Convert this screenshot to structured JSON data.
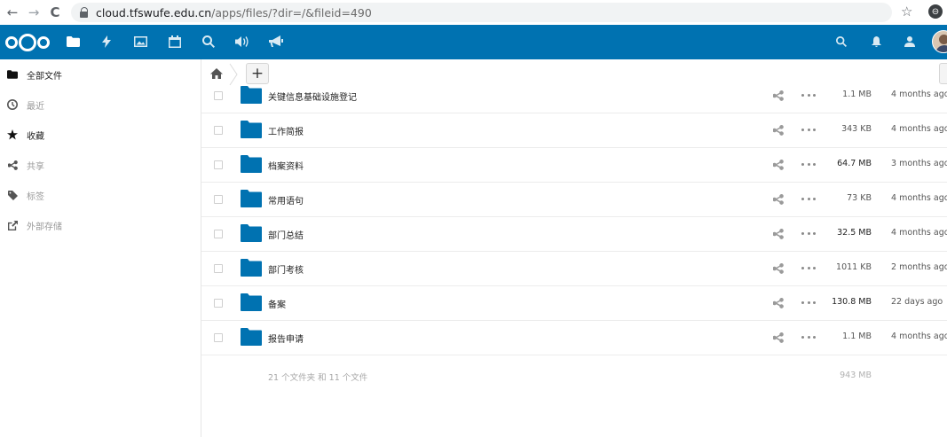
{
  "browser": {
    "back": "←",
    "forward": "→",
    "reload": "C",
    "url_host": "cloud.tfswufe.edu.cn",
    "url_path": "/apps/files/?dir=/&fileid=490",
    "star": "☆",
    "profile": "⊖"
  },
  "header": {
    "app_icons": [
      "files-icon",
      "activity-icon",
      "photos-icon",
      "calendar-icon",
      "search-icon",
      "audio-icon",
      "announcements-icon"
    ],
    "right_icons": [
      "search-icon",
      "notifications-icon",
      "contacts-icon"
    ]
  },
  "sidebar": {
    "items": [
      {
        "label": "全部文件",
        "icon": "folder-icon"
      },
      {
        "label": "最近",
        "icon": "clock-icon"
      },
      {
        "label": "收藏",
        "icon": "star-icon"
      },
      {
        "label": "共享",
        "icon": "share-icon"
      },
      {
        "label": "标签",
        "icon": "tag-icon"
      },
      {
        "label": "外部存储",
        "icon": "external-icon"
      }
    ]
  },
  "breadcrumb": {
    "add_label": "+"
  },
  "files": [
    {
      "name": "关键信息基础设施登记",
      "size": "1.1 MB",
      "modified": "4 months ago"
    },
    {
      "name": "工作简报",
      "size": "343 KB",
      "modified": "4 months ago"
    },
    {
      "name": "档案资料",
      "size": "64.7 MB",
      "modified": "3 months ago"
    },
    {
      "name": "常用语句",
      "size": "73 KB",
      "modified": "4 months ago"
    },
    {
      "name": "部门总结",
      "size": "32.5 MB",
      "modified": "4 months ago"
    },
    {
      "name": "部门考核",
      "size": "1011 KB",
      "modified": "2 months ago"
    },
    {
      "name": "备案",
      "size": "130.8 MB",
      "modified": "22 days ago"
    },
    {
      "name": "报告申请",
      "size": "1.1 MB",
      "modified": "4 months ago"
    }
  ],
  "summary": {
    "text": "21 个文件夹 和 11 个文件",
    "total_size": "943 MB"
  },
  "colors": {
    "header_bg": "#0072b1",
    "folder": "#0072b1"
  }
}
